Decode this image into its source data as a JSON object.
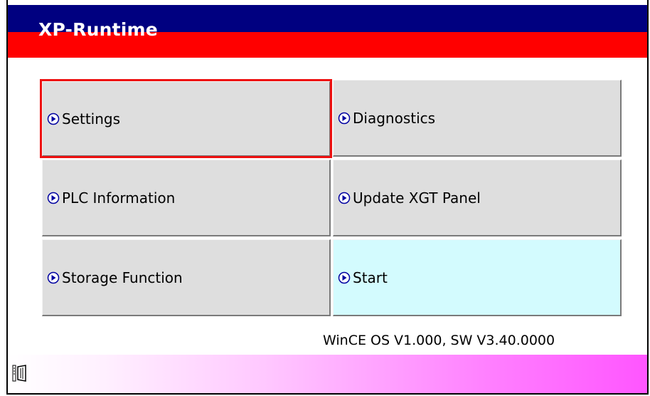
{
  "window": {
    "title": "XP-Runtime"
  },
  "menu": {
    "buttons": [
      {
        "label": "Settings"
      },
      {
        "label": "Diagnostics"
      },
      {
        "label": "PLC Information"
      },
      {
        "label": "Update XGT Panel"
      },
      {
        "label": "Storage Function"
      },
      {
        "label": "Start"
      }
    ]
  },
  "footer": {
    "version_text": "WinCE OS V1.000, SW V3.40.0000"
  },
  "colors": {
    "title_blue": "#000080",
    "title_red": "#ff0000",
    "button_gray": "#dedede",
    "start_cyan": "#d3fbfe",
    "selection_red": "#ee1111",
    "footer_magenta": "#ff55ff"
  },
  "icons": {
    "menu_arrow": "circle-arrow-right-icon",
    "tray": "vnc-icon"
  }
}
